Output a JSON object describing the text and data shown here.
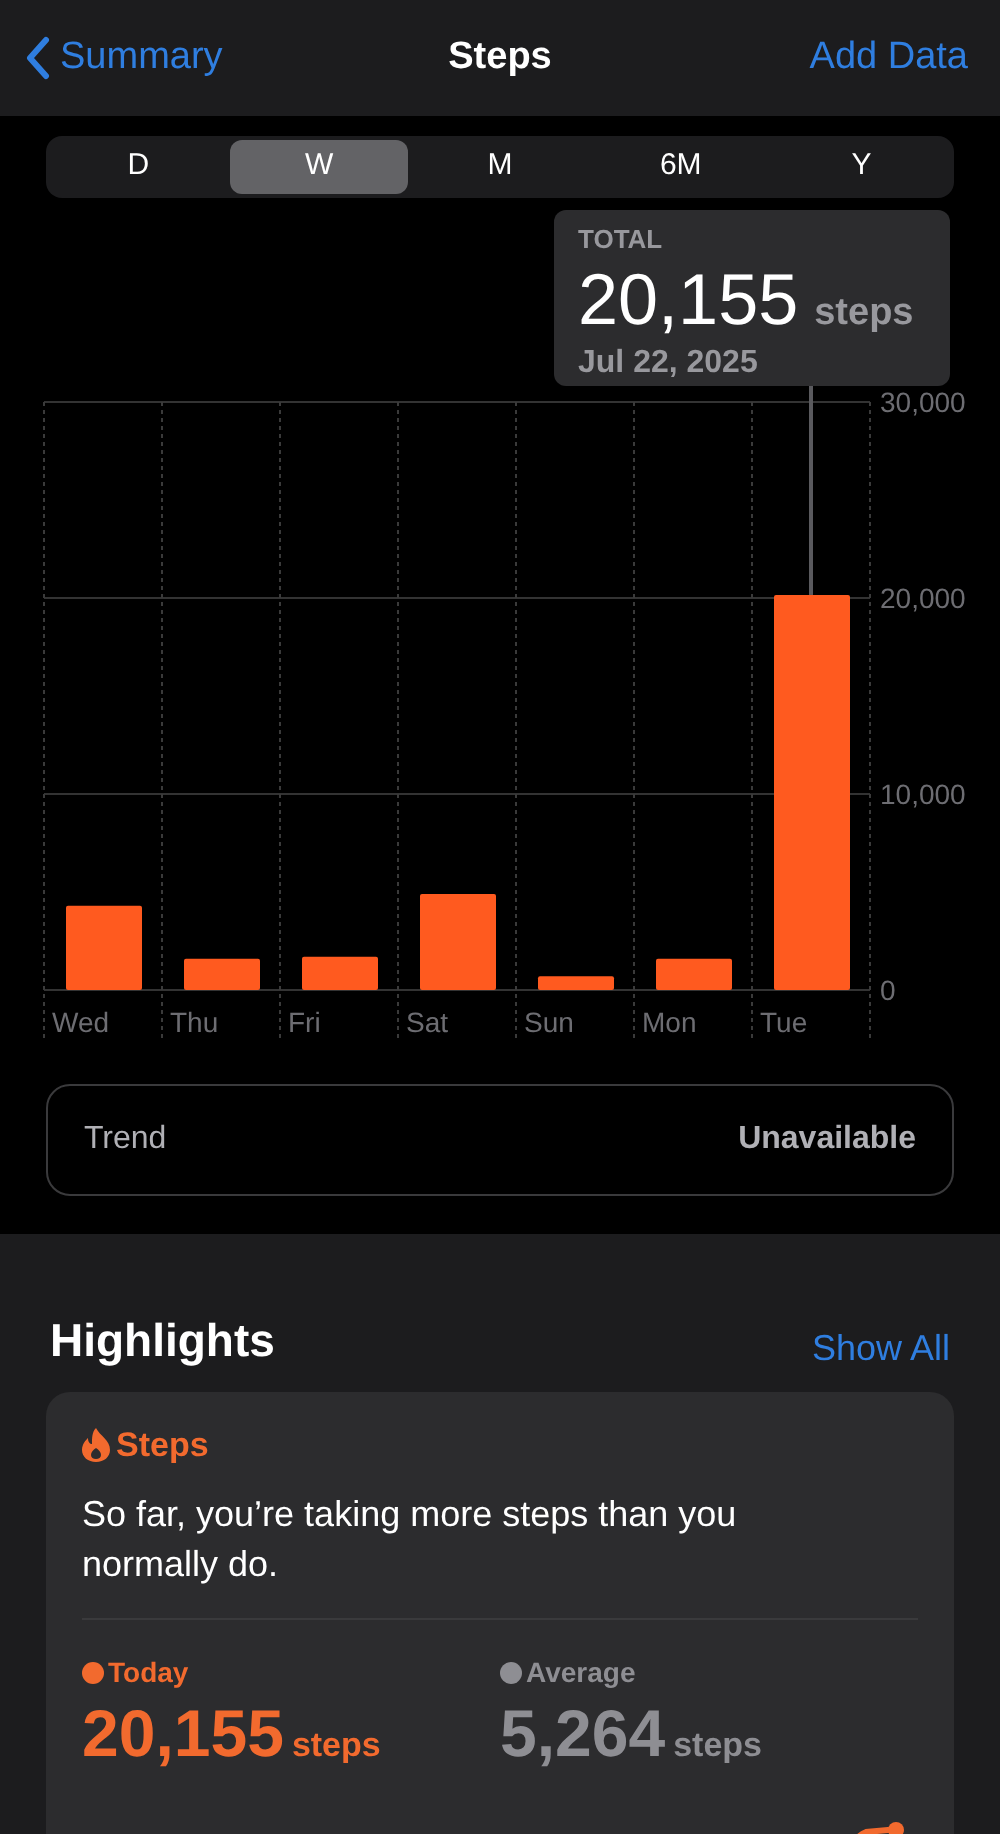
{
  "nav": {
    "back": "Summary",
    "title": "Steps",
    "action": "Add Data"
  },
  "ranges": [
    {
      "label": "D",
      "selected": false
    },
    {
      "label": "W",
      "selected": true
    },
    {
      "label": "M",
      "selected": false
    },
    {
      "label": "6M",
      "selected": false
    },
    {
      "label": "Y",
      "selected": false
    }
  ],
  "callout": {
    "label": "TOTAL",
    "value": "20,155",
    "unit": "steps",
    "date": "Jul 22, 2025"
  },
  "chart": {
    "chart_data": {
      "type": "bar",
      "categories": [
        "Wed",
        "Thu",
        "Fri",
        "Sat",
        "Sun",
        "Mon",
        "Tue"
      ],
      "series": [
        {
          "color": "#ff5a1f",
          "values": [
            4300,
            1600,
            1700,
            4900,
            700,
            1600,
            20155
          ]
        }
      ],
      "ylim": [
        0,
        30000
      ],
      "yticks": [
        {
          "value": 0,
          "label": "0"
        },
        {
          "value": 10000,
          "label": "10,000"
        },
        {
          "value": 20000,
          "label": "20,000"
        },
        {
          "value": 30000,
          "label": "30,000"
        }
      ]
    }
  },
  "trend": {
    "label": "Trend",
    "value": "Unavailable"
  },
  "highlights": {
    "title": "Highlights",
    "action": "Show All",
    "card": {
      "category": "Steps",
      "text": "So far, you’re taking more steps than you normally do.",
      "stats": [
        {
          "label": "Today",
          "value": "20,155",
          "unit": "steps",
          "color": "#f26a2e"
        },
        {
          "label": "Average",
          "value": "5,264",
          "unit": "steps",
          "color": "#8e8e93"
        }
      ]
    }
  }
}
